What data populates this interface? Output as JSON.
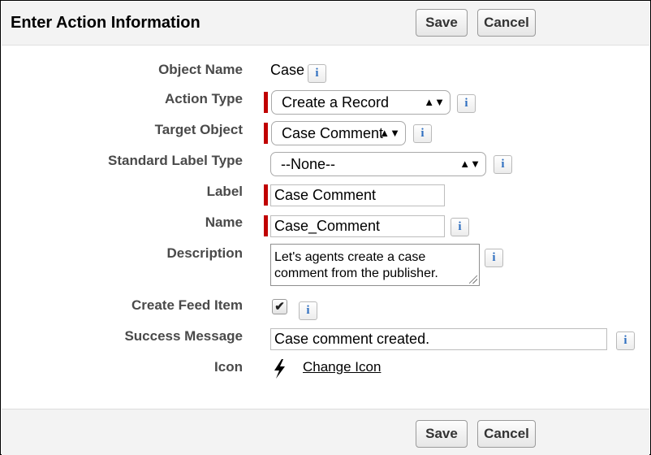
{
  "header": {
    "title": "Enter Action Information",
    "save_label": "Save",
    "cancel_label": "Cancel"
  },
  "footer": {
    "save_label": "Save",
    "cancel_label": "Cancel"
  },
  "info_glyph": "i",
  "form": {
    "object_name": {
      "label": "Object Name",
      "value": "Case"
    },
    "action_type": {
      "label": "Action Type",
      "value": "Create a Record"
    },
    "target_object": {
      "label": "Target Object",
      "value": "Case Comment"
    },
    "standard_label_type": {
      "label": "Standard Label Type",
      "value": "--None--"
    },
    "label": {
      "label": "Label",
      "value": "Case Comment"
    },
    "name": {
      "label": "Name",
      "value": "Case_Comment"
    },
    "description": {
      "label": "Description",
      "value": "Let's agents create a case comment from the publisher."
    },
    "create_feed_item": {
      "label": "Create Feed Item",
      "checked": true,
      "check_glyph": "✔"
    },
    "success_message": {
      "label": "Success Message",
      "value": "Case comment created."
    },
    "icon": {
      "label": "Icon",
      "icon_name": "lightning-bolt-icon",
      "change_label": "Change Icon"
    }
  },
  "colors": {
    "required_bar": "#c00000",
    "info_icon": "#2f6fc0",
    "panel_background": "#f3f3f3"
  }
}
